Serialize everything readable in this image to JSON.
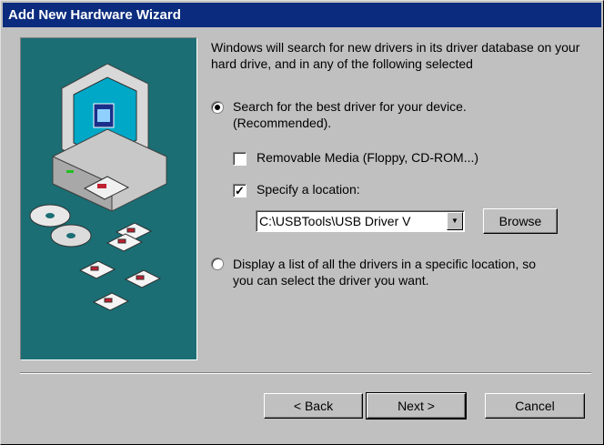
{
  "window": {
    "title": "Add New Hardware Wizard"
  },
  "intro_text": "Windows will search for new drivers in its driver database on your hard drive, and in any of the following selected",
  "options": {
    "search_best": {
      "label_line1": "Search for the best driver for your device.",
      "label_line2": "(Recommended).",
      "selected": true
    },
    "removable_media": {
      "label": "Removable Media (Floppy, CD-ROM...)",
      "checked": false
    },
    "specify_location": {
      "label": "Specify a location:",
      "checked": true
    },
    "location_value": "C:\\USBTools\\USB Driver V",
    "display_list": {
      "label_line1": "Display a list of all the drivers in a specific location, so",
      "label_line2": "you can select the driver you want.",
      "selected": false
    }
  },
  "buttons": {
    "browse": "Browse",
    "back": "< Back",
    "next": "Next >",
    "cancel": "Cancel"
  },
  "colors": {
    "title_bar": "#0b2c7e",
    "art_background": "#1a6e74",
    "face": "#c0c0c0"
  }
}
